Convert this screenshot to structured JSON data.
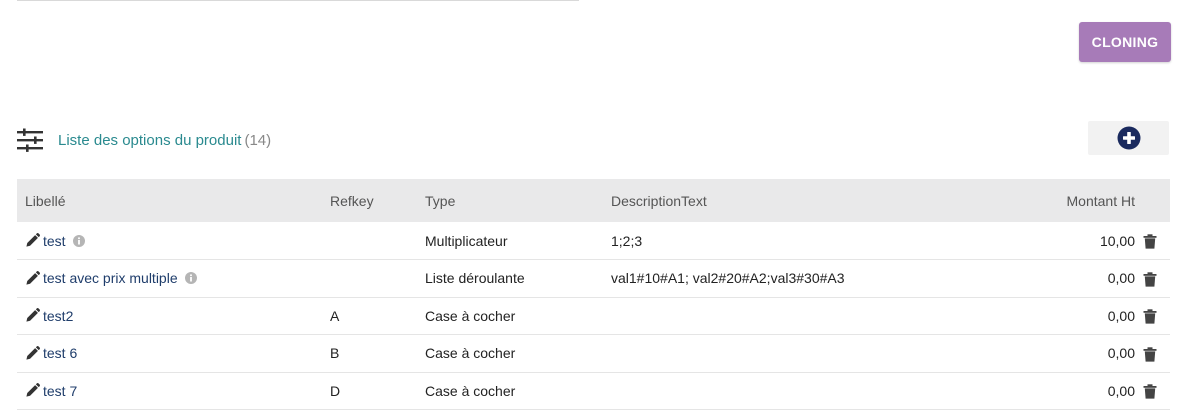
{
  "toolbar": {
    "cloning_label": "CLONING"
  },
  "section": {
    "title": "Liste des options du produit",
    "count": "(14)"
  },
  "table": {
    "headers": {
      "libelle": "Libellé",
      "refkey": "Refkey",
      "type": "Type",
      "description": "DescriptionText",
      "montant": "Montant Ht"
    },
    "rows": [
      {
        "libelle": "test",
        "has_info": true,
        "refkey": "",
        "type": "Multiplicateur",
        "description": "1;2;3",
        "montant": "10,00"
      },
      {
        "libelle": "test avec prix multiple",
        "has_info": true,
        "refkey": "",
        "type": "Liste déroulante",
        "description": "val1#10#A1; val2#20#A2;val3#30#A3",
        "montant": "0,00"
      },
      {
        "libelle": "test2",
        "has_info": false,
        "refkey": "A",
        "type": "Case à cocher",
        "description": "",
        "montant": "0,00"
      },
      {
        "libelle": "test 6",
        "has_info": false,
        "refkey": "B",
        "type": "Case à cocher",
        "description": "",
        "montant": "0,00"
      },
      {
        "libelle": "test 7",
        "has_info": false,
        "refkey": "D",
        "type": "Case à cocher",
        "description": "",
        "montant": "0,00"
      }
    ]
  },
  "colors": {
    "cloning_button": "#a77bb8",
    "section_title": "#2a8a8f",
    "link": "#1f3d6b",
    "add_icon": "#1a2a5e",
    "header_bg": "#e9e9ea"
  },
  "icons": [
    "sliders-icon",
    "plus-circle-icon",
    "pencil-icon",
    "info-icon",
    "trash-icon"
  ]
}
